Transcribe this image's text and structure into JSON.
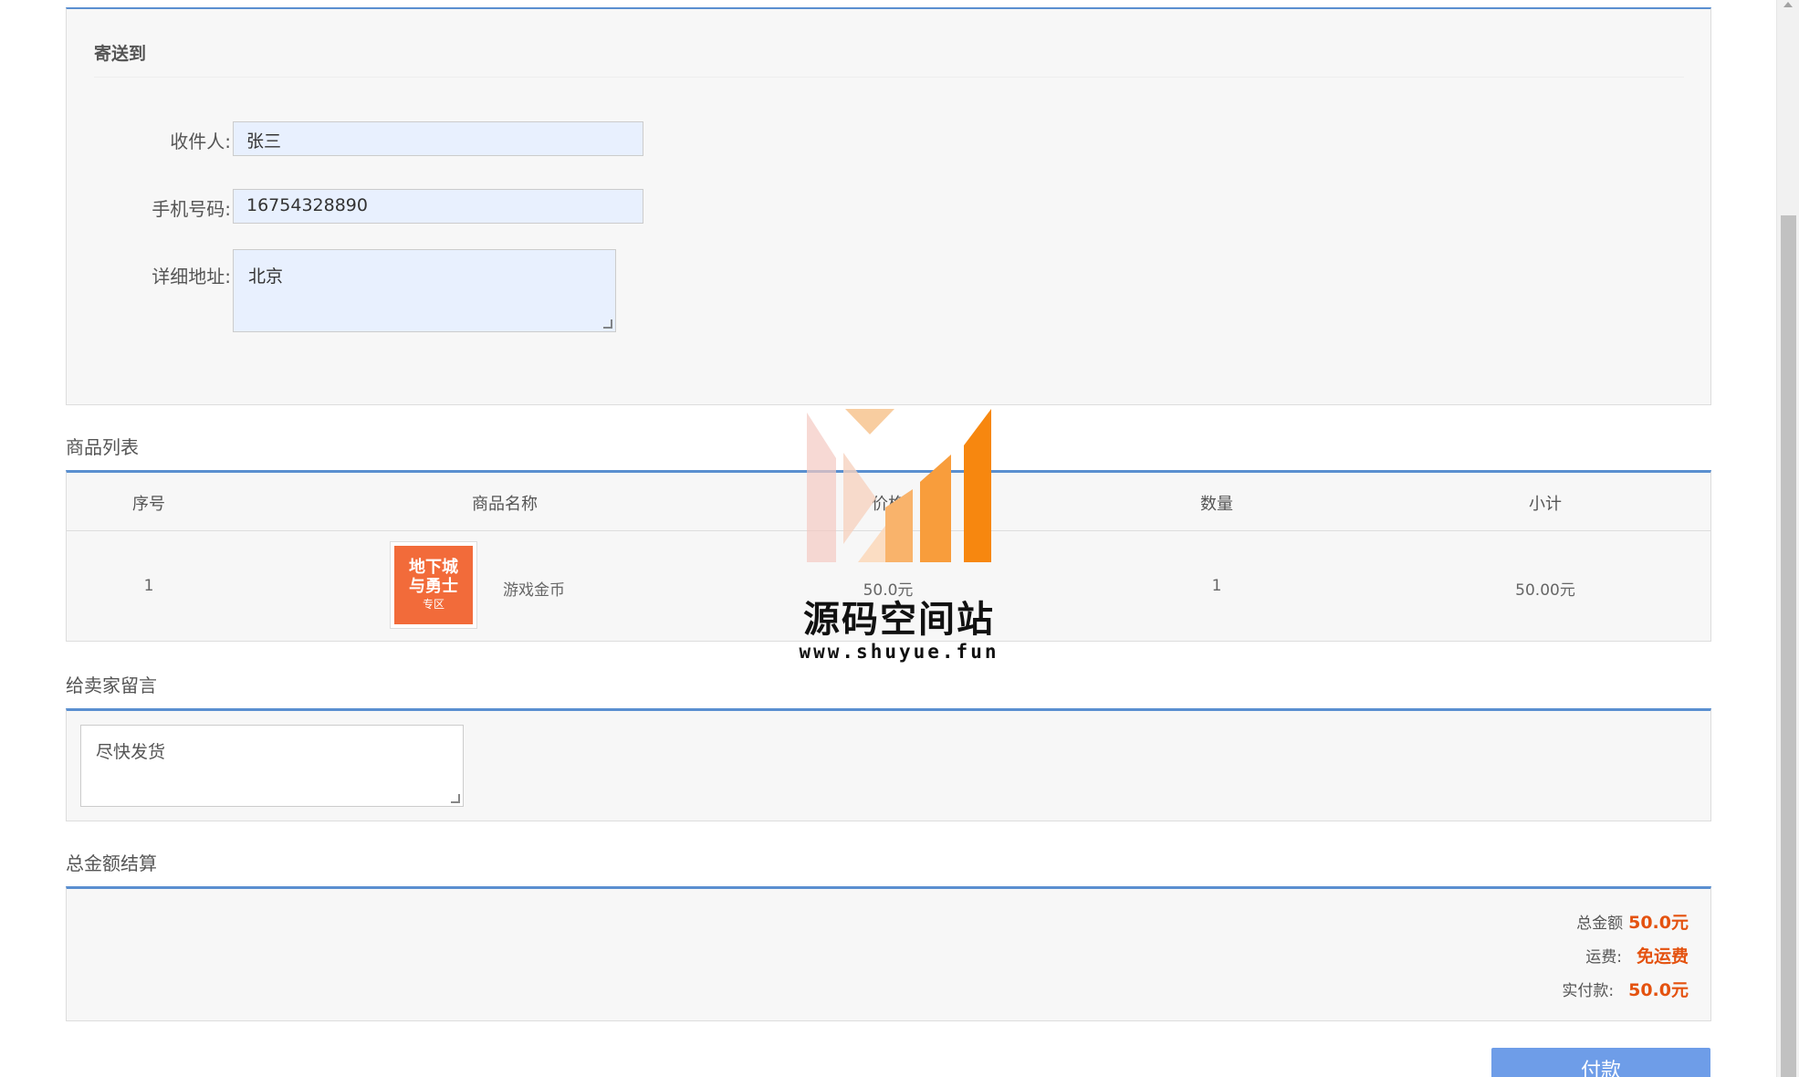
{
  "shipping": {
    "title": "寄送到",
    "recipient_label": "收件人:",
    "recipient_value": "张三",
    "phone_label": "手机号码:",
    "phone_value": "16754328890",
    "address_label": "详细地址:",
    "address_value": "北京"
  },
  "products": {
    "section_title": "商品列表",
    "headers": {
      "index": "序号",
      "name": "商品名称",
      "price": "价格",
      "quantity": "数量",
      "subtotal": "小计"
    },
    "rows": [
      {
        "index": "1",
        "thumb_text_1": "地下城",
        "thumb_text_2": "与勇士",
        "thumb_text_3": "专区",
        "name": "游戏金币",
        "price": "50.0元",
        "quantity": "1",
        "subtotal": "50.00元"
      }
    ]
  },
  "message": {
    "section_title": "给卖家留言",
    "value": "尽快发货"
  },
  "total": {
    "section_title": "总金额结算",
    "amount_label": "总金额",
    "amount_value": "50.0元",
    "shipping_label": "运费:",
    "shipping_value": "免运费",
    "paid_label": "实付款:",
    "paid_value": "50.0元"
  },
  "pay_button_label": "付款",
  "watermark": {
    "title": "源码空间站",
    "url": "www.shuyue.fun"
  },
  "colors": {
    "accent_border": "#5a8fd0",
    "price_highlight": "#e4520f",
    "pay_button": "#6e9de8",
    "input_bg": "#e8f0fe"
  }
}
